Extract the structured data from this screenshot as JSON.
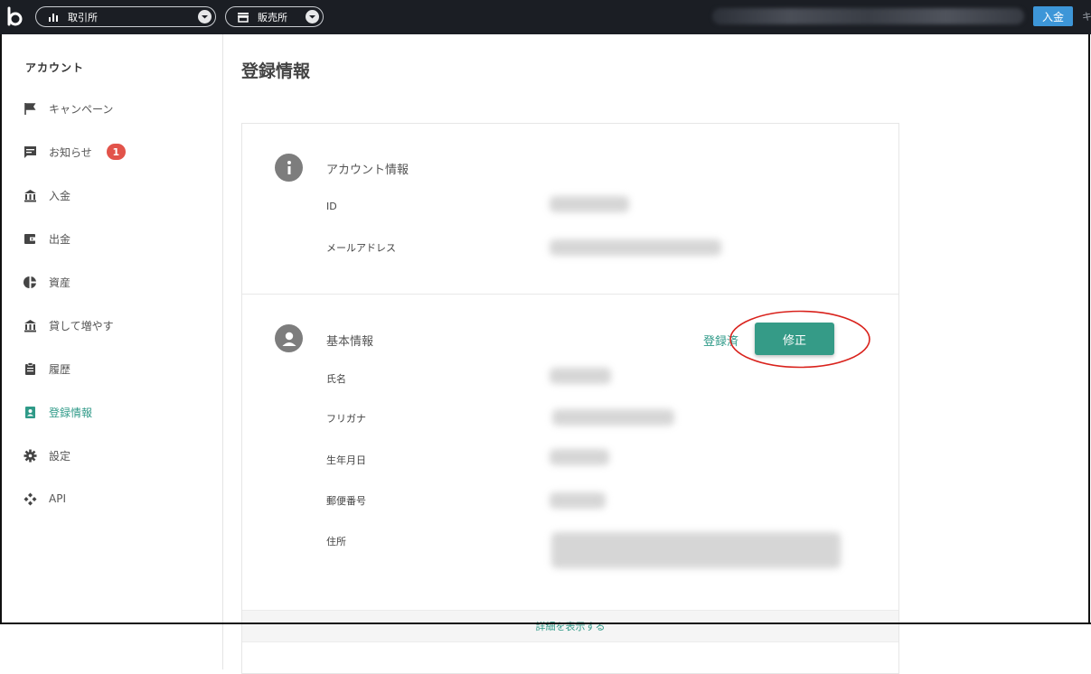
{
  "topbar": {
    "exchange_label": "取引所",
    "store_label": "販売所",
    "deposit_label": "入金",
    "cut_text": "キ"
  },
  "sidebar": {
    "title": "アカウント",
    "items": [
      {
        "label": "キャンペーン",
        "icon": "flag-icon"
      },
      {
        "label": "お知らせ",
        "icon": "message-icon",
        "badge": "1"
      },
      {
        "label": "入金",
        "icon": "bank-icon"
      },
      {
        "label": "出金",
        "icon": "wallet-icon"
      },
      {
        "label": "資産",
        "icon": "pie-chart-icon"
      },
      {
        "label": "貸して増やす",
        "icon": "bank-icon"
      },
      {
        "label": "履歴",
        "icon": "clipboard-icon"
      },
      {
        "label": "登録情報",
        "icon": "contact-card-icon",
        "active": true
      },
      {
        "label": "設定",
        "icon": "gear-icon"
      },
      {
        "label": "API",
        "icon": "api-icon"
      }
    ]
  },
  "main": {
    "title": "登録情報",
    "account_section": {
      "title": "アカウント情報",
      "fields": [
        {
          "label": "ID"
        },
        {
          "label": "メールアドレス"
        }
      ]
    },
    "basic_section": {
      "title": "基本情報",
      "status": "登録済",
      "edit_label": "修正",
      "fields": [
        {
          "label": "氏名"
        },
        {
          "label": "フリガナ"
        },
        {
          "label": "生年月日"
        },
        {
          "label": "郵便番号"
        },
        {
          "label": "住所"
        }
      ]
    },
    "show_more": "詳細を表示する"
  },
  "colors": {
    "accent": "#2f9a88",
    "topbar": "#1b1e24",
    "deposit": "#3d96d8",
    "badge": "#e2534a",
    "annotation": "#d9221c"
  }
}
